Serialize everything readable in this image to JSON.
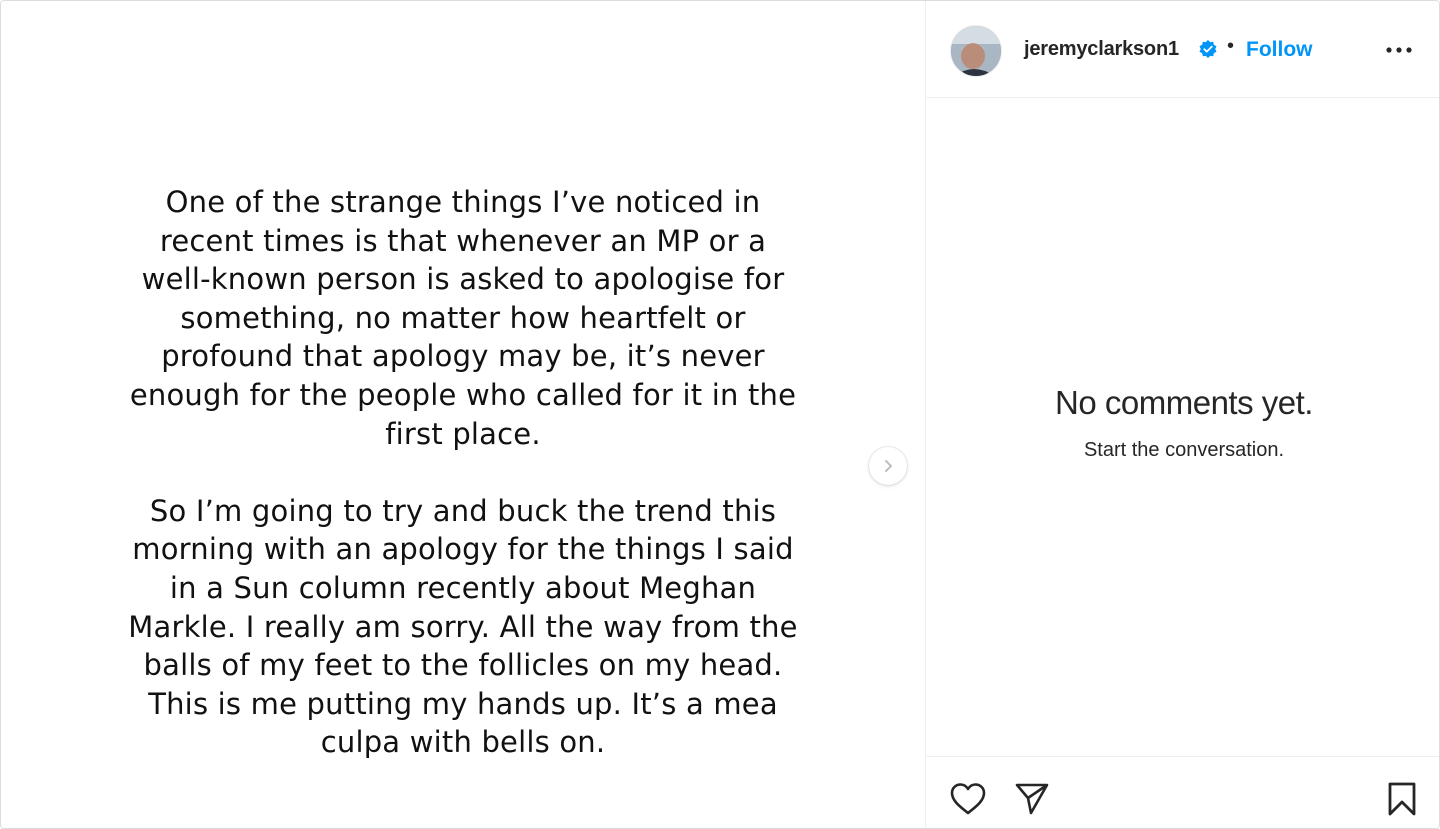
{
  "post": {
    "paragraphs": [
      "One of the strange things I’ve noticed in recent times is that whenever an MP or a well-known person is asked to apologise for something, no matter how heartfelt or profound that apology may be, it’s never enough for the people who called for it in the first place.",
      "So I’m going to try and buck the trend this morning with an apology for the things I said in a Sun column recently about Meghan Markle. I really am sorry. All the way from the balls of my feet to the follicles on my head. This is me putting my hands up. It’s a mea culpa with bells on."
    ]
  },
  "header": {
    "username": "jeremyclarkson1",
    "separator": "•",
    "follow_label": "Follow"
  },
  "comments": {
    "empty_title": "No comments yet.",
    "empty_subtitle": "Start the conversation."
  },
  "icons": {
    "avatar": "avatar",
    "verified": "verified-badge-icon",
    "more": "more-options-icon",
    "next": "chevron-right-icon",
    "like": "heart-icon",
    "share": "paper-plane-icon",
    "save": "bookmark-icon"
  },
  "colors": {
    "accent": "#0095f6",
    "text": "#262626",
    "border": "#efefef"
  }
}
